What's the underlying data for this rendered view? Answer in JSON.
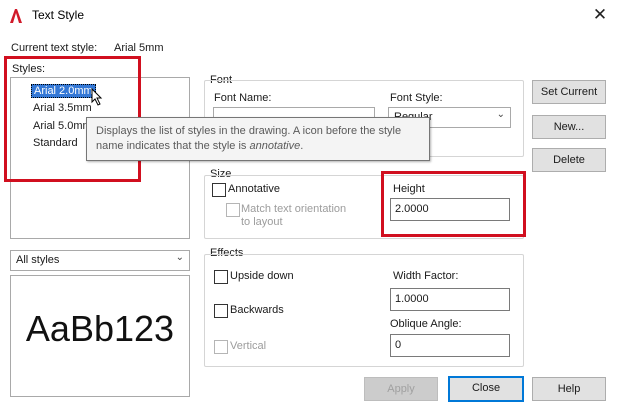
{
  "window": {
    "title": "Text Style",
    "close_glyph": "✕"
  },
  "current_style": {
    "label": "Current text style:",
    "value": "Arial 5mm"
  },
  "styles": {
    "label": "Styles:",
    "items": [
      "Arial 2.0mm",
      "Arial 3.5mm",
      "Arial 5.0mm",
      "Standard"
    ],
    "selected_index": 0,
    "filter_value": "All styles"
  },
  "tooltip": {
    "line1": "Displays the list of styles in the drawing. A icon before the style",
    "line2_prefix": "name indicates that the style is ",
    "line2_italic": "annotative",
    "line2_suffix": "."
  },
  "font": {
    "group_label": "Font",
    "name_label": "Font Name:",
    "style_label": "Font Style:",
    "style_value": "Regular"
  },
  "size": {
    "group_label": "Size",
    "annotative_label": "Annotative",
    "match_label_1": "Match text orientation",
    "match_label_2": "to layout",
    "height_label": "Height",
    "height_value": "2.0000"
  },
  "effects": {
    "group_label": "Effects",
    "upside_down_label": "Upside down",
    "backwards_label": "Backwards",
    "vertical_label": "Vertical",
    "width_factor_label": "Width Factor:",
    "width_factor_value": "1.0000",
    "oblique_label": "Oblique Angle:",
    "oblique_value": "0"
  },
  "preview": {
    "text": "AaBb123"
  },
  "buttons": {
    "set_current": "Set Current",
    "new": "New...",
    "delete": "Delete",
    "apply": "Apply",
    "close": "Close",
    "help": "Help"
  },
  "colors": {
    "highlight": "#d10f1f",
    "selection": "#3478d6",
    "accent": "#0078d7"
  }
}
